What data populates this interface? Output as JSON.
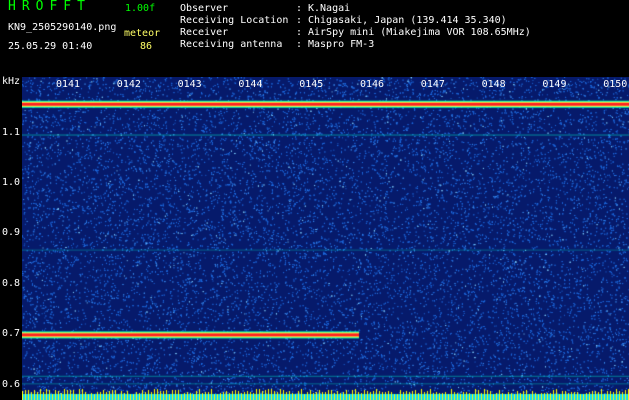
{
  "app": {
    "name": "HROFFT",
    "version": "1.00f"
  },
  "file": {
    "name": "KN9_2505290140.png",
    "datetime": "25.05.29 01:40"
  },
  "meteor": {
    "label": "meteor",
    "count": "86"
  },
  "info": [
    {
      "label": "Observer",
      "value": "K.Nagai"
    },
    {
      "label": "Receiving Location",
      "value": "Chigasaki, Japan (139.414 35.340)"
    },
    {
      "label": "Receiver",
      "value": "AirSpy mini (Miakejima VOR 108.65MHz)"
    },
    {
      "label": "Receiving antenna",
      "value": "Maspro FM-3"
    }
  ],
  "spectrogram": {
    "y_unit": "kHz",
    "y_ticks": [
      "1.1",
      "1.0",
      "0.9",
      "0.8",
      "0.7",
      "0.6"
    ],
    "y_range": [
      0.57,
      1.21
    ],
    "time_marks": [
      "0141",
      "0142",
      "0143",
      "0144",
      "0145",
      "0146",
      "0147",
      "0148",
      "0149",
      "0150"
    ],
    "colors": {
      "background": "#061a6b",
      "noise": "#1e6be0",
      "signal": "#ff2020",
      "line": "#00e6c8",
      "bottom_band": "#00d8ff",
      "bottom_ticks": "#ffff00"
    }
  }
}
